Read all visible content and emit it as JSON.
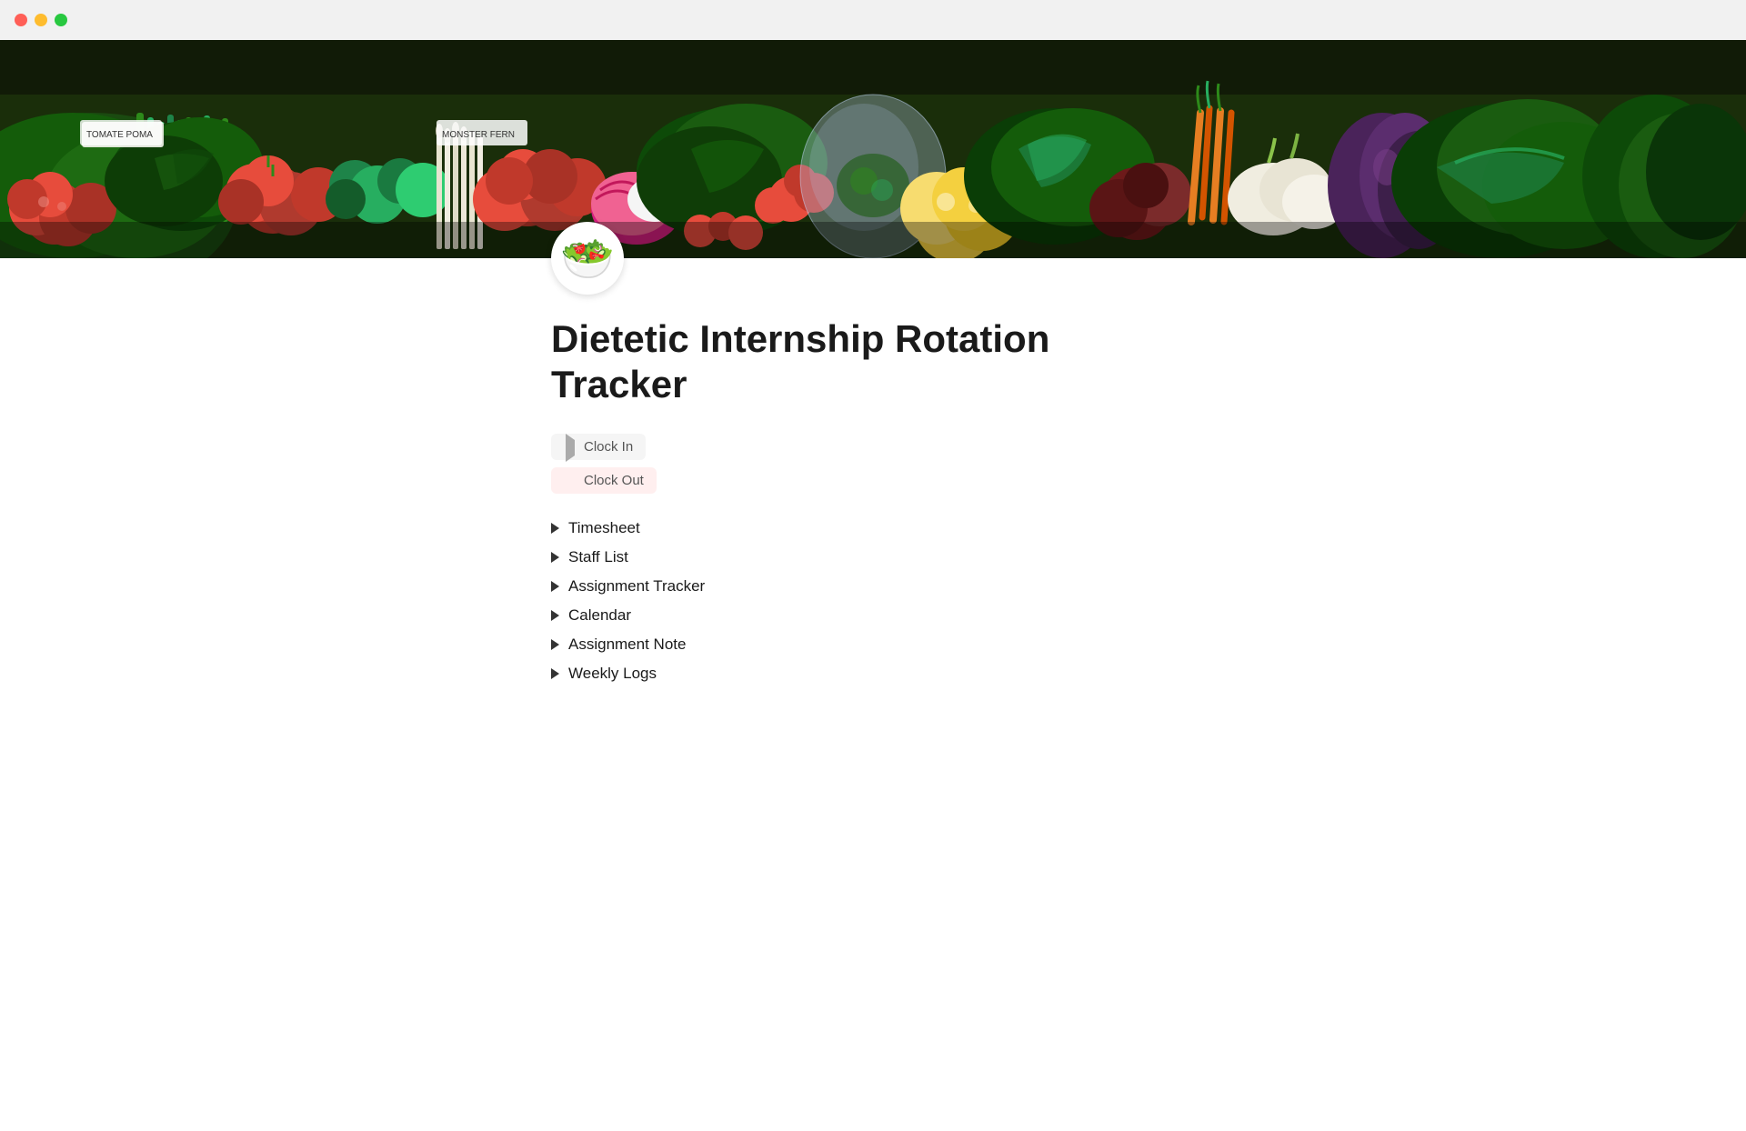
{
  "titlebar": {
    "buttons": {
      "close_label": "close",
      "minimize_label": "minimize",
      "maximize_label": "maximize"
    }
  },
  "page": {
    "icon": "🥗",
    "title": "Dietetic Internship Rotation Tracker"
  },
  "actions": {
    "clock_in_label": "Clock In",
    "clock_out_label": "Clock Out"
  },
  "nav_items": [
    {
      "label": "Timesheet",
      "id": "timesheet"
    },
    {
      "label": "Staff List",
      "id": "staff-list"
    },
    {
      "label": "Assignment Tracker",
      "id": "assignment-tracker"
    },
    {
      "label": "Calendar",
      "id": "calendar"
    },
    {
      "label": "Assignment Note",
      "id": "assignment-note"
    },
    {
      "label": "Weekly Logs",
      "id": "weekly-logs"
    }
  ]
}
